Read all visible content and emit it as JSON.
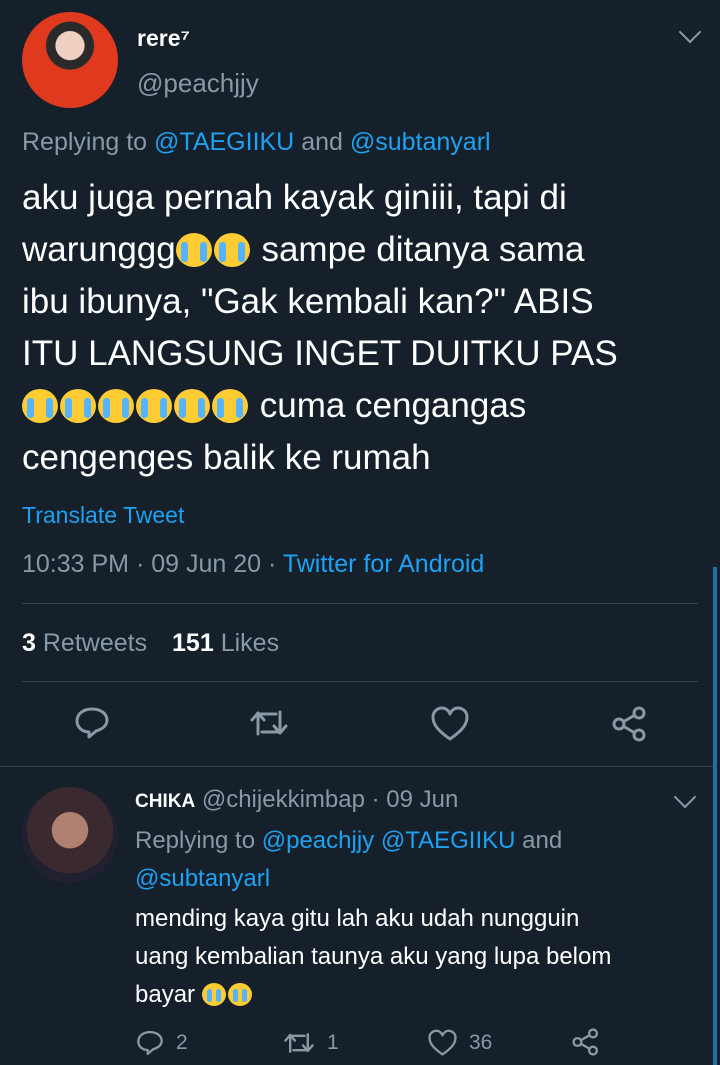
{
  "tweet": {
    "display_name": "rere⁷",
    "handle": "@peachjjy",
    "replying_prefix": "Replying to ",
    "replying_to_1": "@TAEGIIKU",
    "replying_and": " and ",
    "replying_to_2": "@subtanyarl",
    "text_line1": "aku juga pernah kayak giniii, tapi di",
    "text_line2_a": "warunggg",
    "text_line2_b": " sampe ditanya sama",
    "text_line3": "ibu ibunya, \"Gak kembali kan?\" ABIS",
    "text_line4": "ITU LANGSUNG INGET DUITKU PAS",
    "text_line5_b": " cuma cengangas",
    "text_line6": "cengenges balik ke rumah",
    "translate": "Translate Tweet",
    "time": "10:33 PM",
    "date_sep": " · ",
    "date": "09 Jun 20",
    "source": "Twitter for Android",
    "retweets_count": "3",
    "retweets_label": "Retweets",
    "likes_count": "151",
    "likes_label": "Likes"
  },
  "reply": {
    "display_name": "CHIKA",
    "handle": "@chijekkimbap",
    "date": "· 09 Jun",
    "replying_prefix": "Replying to ",
    "replying_to_1": "@peachjjy",
    "replying_to_2": "@TAEGIIKU",
    "replying_and": " and",
    "replying_to_3": "@subtanyarl",
    "text_line1": "mending kaya gitu lah aku udah nungguin",
    "text_line2": "uang kembalian taunya aku yang lupa belom",
    "text_line3": "bayar",
    "reply_count": "2",
    "retweet_count": "1",
    "like_count": "36"
  },
  "icons": [
    "chevron-down-icon",
    "reply-icon",
    "retweet-icon",
    "like-icon",
    "share-icon",
    "crying-emoji-icon"
  ],
  "colors": {
    "background": "#15202b",
    "link": "#1da1f2",
    "muted": "#8899a6",
    "divider": "#38444d"
  }
}
